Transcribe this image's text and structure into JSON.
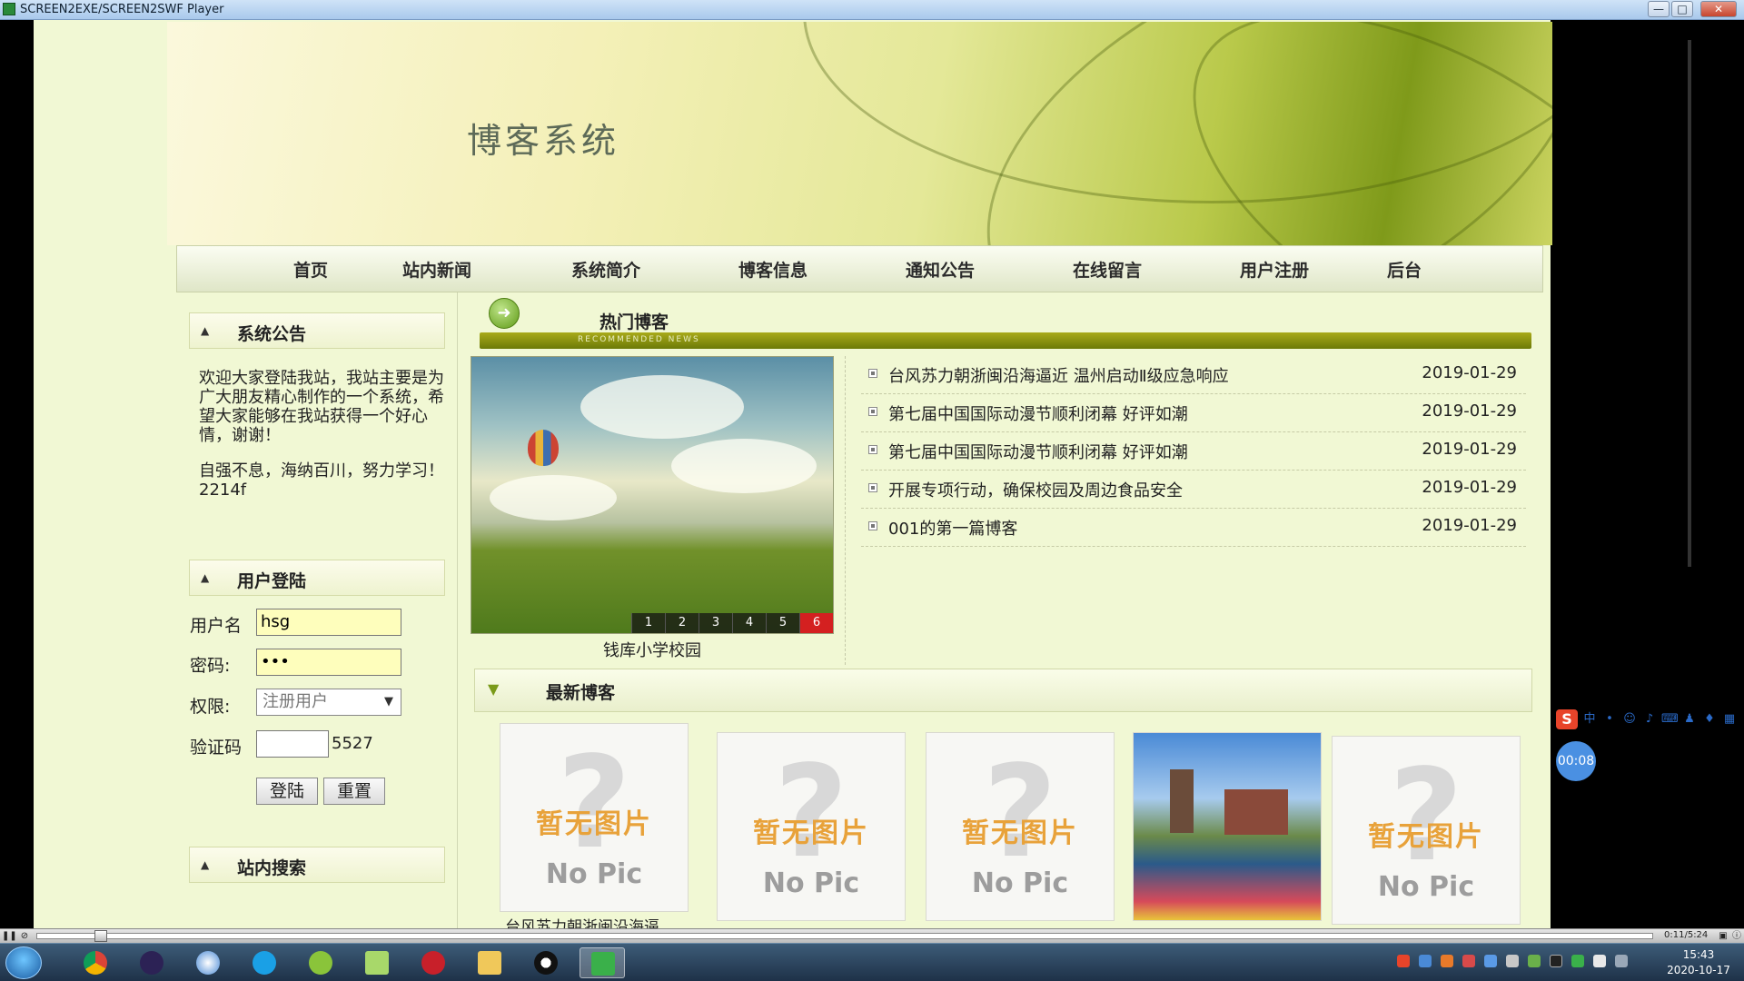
{
  "window": {
    "title": "SCREEN2EXE/SCREEN2SWF Player",
    "buttons": {
      "minimize": "—",
      "maximize": "□",
      "close": "✕"
    }
  },
  "site": {
    "title": "博客系统"
  },
  "nav": {
    "items": [
      "首页",
      "站内新闻",
      "系统简介",
      "博客信息",
      "通知公告",
      "在线留言",
      "用户注册",
      "后台"
    ]
  },
  "sidebar": {
    "notice": {
      "title": "系统公告",
      "para1": "欢迎大家登陆我站，我站主要是为广大朋友精心制作的一个系统，希望大家能够在我站获得一个好心情，谢谢！",
      "para2": "自强不息，海纳百川，努力学习！2214f"
    },
    "login": {
      "title": "用户登陆",
      "username_label": "用户名",
      "username_value": "hsg",
      "password_label": "密码:",
      "password_value": "•••",
      "role_label": "权限:",
      "role_value": "注册用户",
      "captcha_label": "验证码",
      "captcha_value": "",
      "captcha_code": "5527",
      "login_button": "登陆",
      "reset_button": "重置"
    },
    "search": {
      "title": "站内搜索"
    }
  },
  "hot": {
    "title": "热门博客",
    "subtitle": "RECOMMENDED NEWS",
    "slide": {
      "caption": "钱库小学校园",
      "pages": [
        "1",
        "2",
        "3",
        "4",
        "5",
        "6"
      ],
      "active_page": "6"
    },
    "news": [
      {
        "title": "台风苏力朝浙闽沿海逼近 温州启动Ⅱ级应急响应",
        "date": "2019-01-29"
      },
      {
        "title": "第七届中国国际动漫节顺利闭幕 好评如潮",
        "date": "2019-01-29"
      },
      {
        "title": "第七届中国国际动漫节顺利闭幕 好评如潮",
        "date": "2019-01-29"
      },
      {
        "title": "开展专项行动，确保校园及周边食品安全",
        "date": "2019-01-29"
      },
      {
        "title": "001的第一篇博客",
        "date": "2019-01-29"
      }
    ]
  },
  "latest": {
    "title": "最新博客",
    "nopic_cn": "暂无图片",
    "nopic_en": "No Pic",
    "first_caption": "台风苏力朝浙闽沿海逼"
  },
  "overlay": {
    "ime_logo": "S",
    "ime_mode": "中",
    "timer": "00:08"
  },
  "player": {
    "time": "0:11/5:24"
  },
  "taskbar": {
    "time": "15:43",
    "date": "2020-10-17"
  },
  "colors": {
    "page_bg": "#f1f8d4",
    "hot_bar": "#8a950e",
    "active_page": "#d42020",
    "nopic_text": "#e8a23a",
    "timer_bg": "#4a90e2"
  }
}
